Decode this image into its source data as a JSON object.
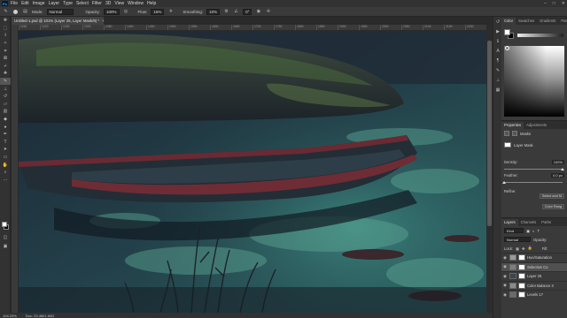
{
  "app": {
    "logo": "Ps"
  },
  "menu": {
    "items": [
      "File",
      "Edit",
      "Image",
      "Layer",
      "Type",
      "Select",
      "Filter",
      "3D",
      "View",
      "Window",
      "Help"
    ]
  },
  "window_controls": [
    "–",
    "□",
    "✕"
  ],
  "options": {
    "mode_label": "Mode:",
    "mode_value": "Normal",
    "opacity_label": "Opacity:",
    "opacity_value": "100%",
    "flow_label": "Flow:",
    "flow_value": "15%",
    "smoothing_label": "Smoothing:",
    "smoothing_value": "10%",
    "angle_value": "0°"
  },
  "document": {
    "tab_title": "Untitled-1.psd @ 101% (Layer 25, Layer Mask/8) *",
    "close": "×"
  },
  "ruler": {
    "ticks": [
      "1150",
      "1200",
      "1250",
      "1300",
      "1350",
      "1400",
      "1450",
      "1500",
      "1550",
      "1600",
      "1650",
      "1700",
      "1750",
      "1800",
      "1850",
      "1900",
      "1950",
      "2000",
      "2050",
      "2100",
      "2150",
      "2200"
    ]
  },
  "status": {
    "zoom": "104.23%",
    "doc_info": "Doc: 23.4M/1.63G"
  },
  "panels": {
    "color_tabs": [
      "Color",
      "Swatches",
      "Gradients",
      "Patterns"
    ],
    "props_tabs": [
      "Properties",
      "Adjustments"
    ],
    "props": {
      "masks_label": "Masks",
      "layer_mask_label": "Layer Mask",
      "density_label": "Density:",
      "density_value": "100%",
      "feather_label": "Feather:",
      "feather_value": "0.0 px",
      "refine_label": "Refine:",
      "select_btn": "Select and M",
      "color_range_btn": "Color Rang"
    },
    "layers_tabs": [
      "Layers",
      "Channels",
      "Paths"
    ],
    "layers": {
      "kind_label": "Kind",
      "blend_mode": "Normal",
      "opacity_label": "Opacity:",
      "lock_label": "Lock:",
      "fill_label": "Fill:",
      "items": [
        {
          "name": "Hue/Saturation",
          "thumb": "#9a9a9a",
          "selected": false
        },
        {
          "name": "Selective Co",
          "thumb": "#7e7e7e",
          "selected": true
        },
        {
          "name": "Layer 25",
          "thumb": "#3a4650",
          "selected": false
        },
        {
          "name": "Color Balance 3",
          "thumb": "#8a8a8a",
          "selected": false
        },
        {
          "name": "Levels 17",
          "thumb": "#6a6a6a",
          "selected": false
        }
      ]
    }
  },
  "tools": [
    "move-icon",
    "marquee-icon",
    "lasso-icon",
    "quick-select-icon",
    "crop-icon",
    "frame-icon",
    "eyedropper-icon",
    "healing-icon",
    "brush-icon",
    "stamp-icon",
    "history-brush-icon",
    "eraser-icon",
    "gradient-icon",
    "blur-icon",
    "dodge-icon",
    "pen-icon",
    "type-icon",
    "path-select-icon",
    "rectangle-icon",
    "hand-icon",
    "zoom-icon",
    "more-icon"
  ]
}
